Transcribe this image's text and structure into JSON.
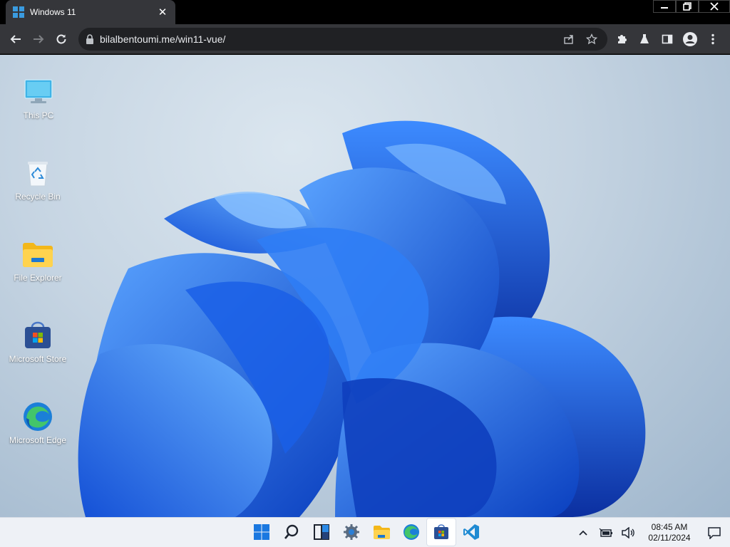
{
  "browser": {
    "tab_title": "Windows 11",
    "url": "bilalbentoumi.me/win11-vue/"
  },
  "desktop": {
    "icons": [
      {
        "label": "This PC",
        "icon": "monitor-icon"
      },
      {
        "label": "Recycle Bin",
        "icon": "recycle-bin-icon"
      },
      {
        "label": "File Explorer",
        "icon": "folder-icon"
      },
      {
        "label": "Microsoft Store",
        "icon": "store-icon"
      },
      {
        "label": "Microsoft Edge",
        "icon": "edge-icon"
      }
    ]
  },
  "taskbar": {
    "apps": [
      "start",
      "search",
      "widgets",
      "settings",
      "file-explorer",
      "edge",
      "store",
      "vscode"
    ],
    "active_app": "store",
    "clock": {
      "time": "08:45 AM",
      "date": "02/11/2024"
    }
  },
  "colors": {
    "accent": "#1f6fe0",
    "taskbar": "#eef1f6",
    "chrome": "#35363a"
  }
}
